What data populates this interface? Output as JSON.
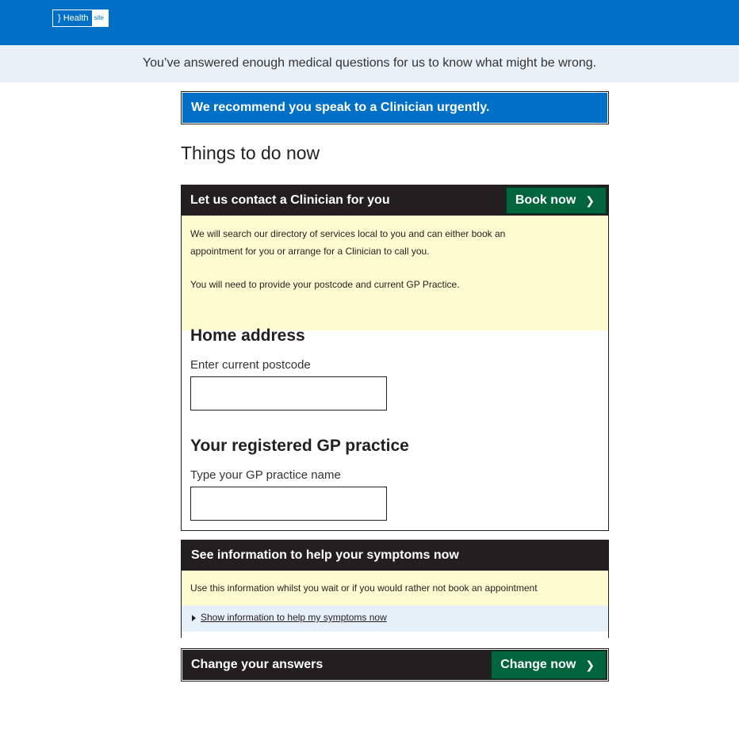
{
  "header": {
    "logo_main": "} Health",
    "logo_sub": "site"
  },
  "notice": "You’ve answered enough medical questions for us to know what might be wrong.",
  "recommendation": "We recommend you speak to a Clinician urgently.",
  "page_heading": "Things to do now",
  "contact_panel": {
    "title": "Let us contact a Clinician for you",
    "button_label": "Book now",
    "description_line1": "We will search our directory of services local to you and can either book an",
    "description_line2": "appointment for you or arrange for a Clinician to call you.",
    "description_note": "You will need to provide your postcode and current GP Practice.",
    "home_address_heading": "Home address",
    "postcode_label": "Enter current postcode",
    "postcode_value": "",
    "gp_heading": "Your registered GP practice",
    "gp_label": "Type your GP practice name",
    "gp_value": ""
  },
  "info_panel": {
    "title": "See information to help your symptoms now",
    "description": "Use this information whilst you wait or if you would rather not book an appointment",
    "link_label": "Show information to help my symptoms now"
  },
  "change_panel": {
    "title": "Change your answers",
    "button_label": "Change now"
  },
  "icons": {
    "chevron": "chevron-right-icon",
    "toggle": "triangle-right-icon"
  },
  "colors": {
    "brand_blue": "#006fc6",
    "notice_bg": "#e8f1f8",
    "dark_header": "#231f20",
    "cta_green": "#00643c",
    "info_yellow": "#fffbd0"
  }
}
